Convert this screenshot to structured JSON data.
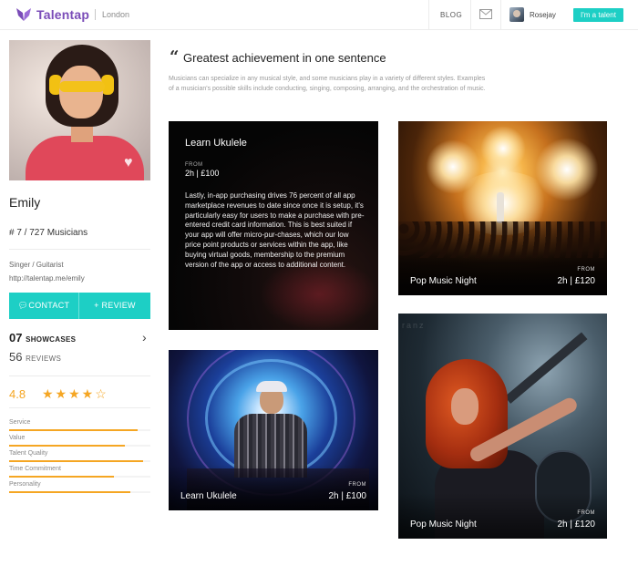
{
  "header": {
    "brand": "Talentap",
    "city": "London",
    "nav_blog": "BLOG",
    "username": "Rosejay",
    "talent_button": "I'm a talent",
    "accent_color": "#1dcfc5",
    "brand_color": "#7a4cb8"
  },
  "profile": {
    "name": "Emily",
    "rank": "# 7 / 727 Musicians",
    "role": "Singer / Guitarist",
    "link": "http://talentap.me/emily",
    "contact_button": "CONTACT",
    "review_button": "+ REVIEW",
    "showcases_count": "07",
    "showcases_label": "SHOWCASES",
    "reviews_count": "56",
    "reviews_label": "REVIEWS",
    "rating": "4.8",
    "stars_display": "★★★★☆",
    "stars_filled": 4,
    "stars_total": 5,
    "metrics": [
      {
        "label": "Service",
        "level": 0.91
      },
      {
        "label": "Value",
        "level": 0.82
      },
      {
        "label": "Talent Quality",
        "level": 0.95
      },
      {
        "label": "Time Commitment",
        "level": 0.74
      },
      {
        "label": "Personality",
        "level": 0.86
      }
    ]
  },
  "main": {
    "headline": "Greatest achievement in one sentence",
    "description": "Musicians can specialize in any musical style, and some musicians play in a variety of different styles. Examples of a musician's possible skills include conducting, singing, composing, arranging, and the orchestration of music.",
    "text_card": {
      "title": "Learn Ukulele",
      "from_label": "FROM",
      "price": "2h | £100",
      "body": "Lastly, in-app purchasing drives 76 percent of all app marketplace revenues to date since once it is setup, it's particularly easy for users to make a purchase with pre-entered credit card information. This is best suited if your app will offer micro-pur-chases, which our low price point products or services within the app, like buying virtual goods, membership to the premium version of the app or access to additional content."
    },
    "showcases": [
      {
        "title": "Pop Music Night",
        "from_label": "FROM",
        "price": "2h | £120"
      },
      {
        "title": "Learn Ukulele",
        "from_label": "FROM",
        "price": "2h | £100"
      },
      {
        "title": "Pop Music Night",
        "from_label": "FROM",
        "price": "2h | £120"
      }
    ]
  }
}
